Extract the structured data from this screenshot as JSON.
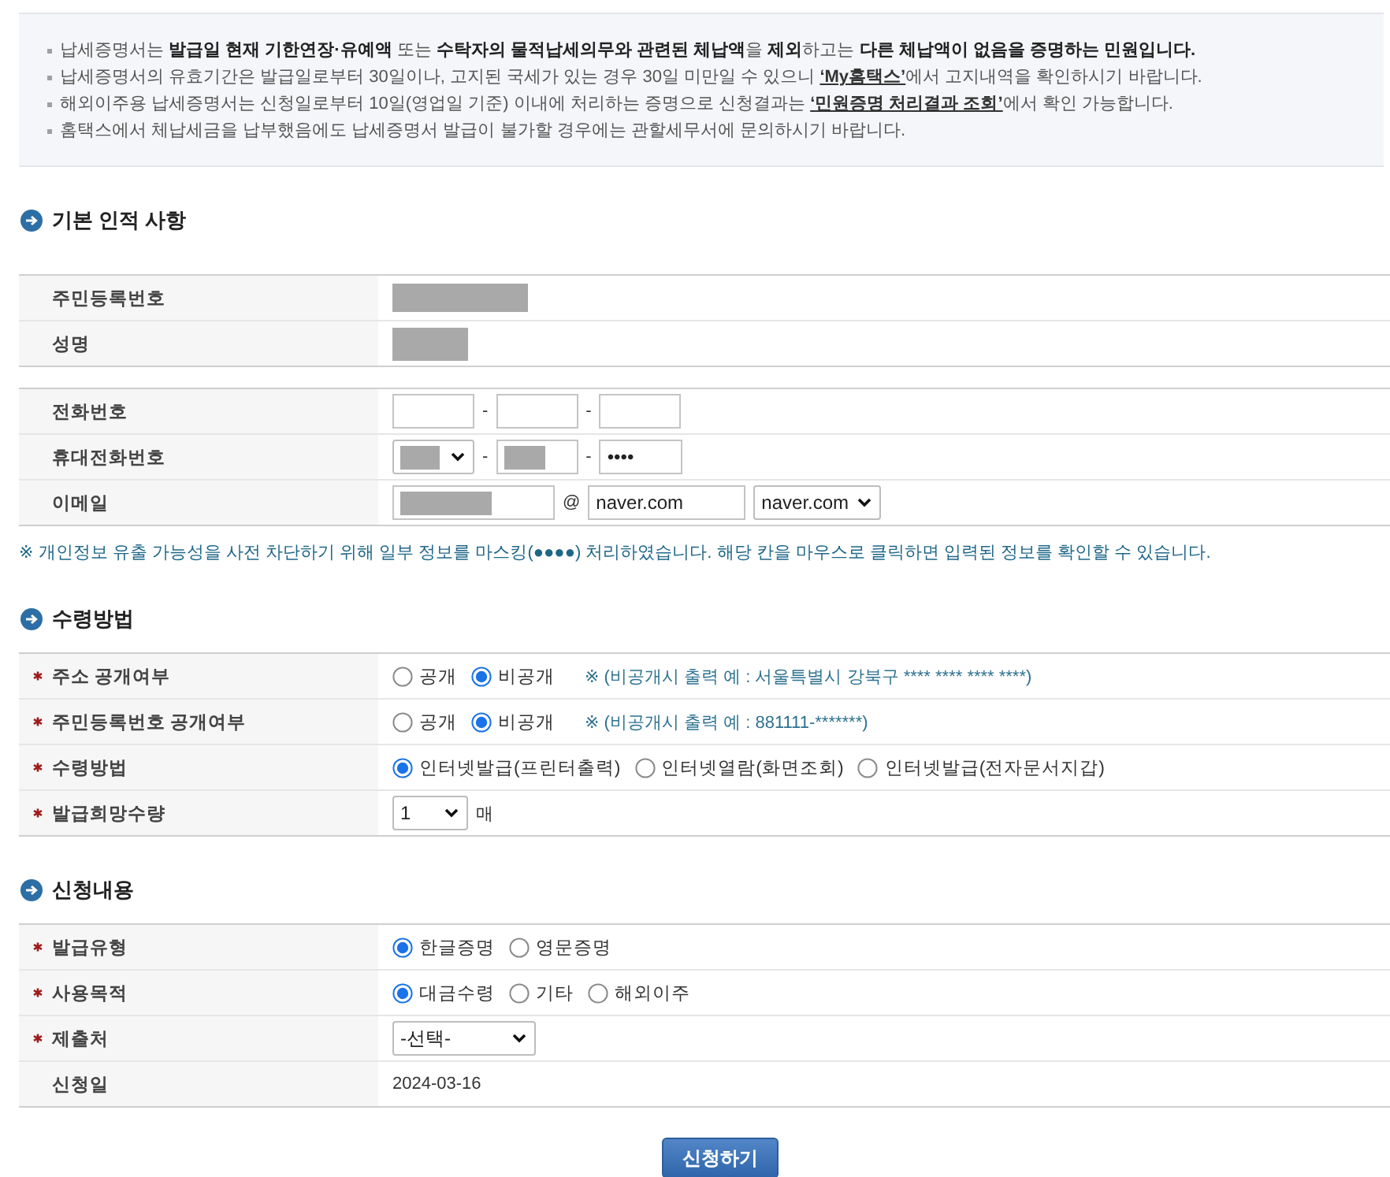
{
  "notice": {
    "items": [
      {
        "parts": [
          {
            "kind": "text",
            "text": "납세증명서는 **발급일 현재 기한연장·유예액** 또는 **수탁자의 물적납세의무와 관련된 체납액**을 **제외**하고는 **다른 체납액이 없음을 증명하는 민원입니다.**"
          }
        ]
      },
      {
        "parts": [
          {
            "kind": "text",
            "text": "납세증명서의 유효기간은 발급일로부터 30일이나, 고지된 국세가 있는 경우 30일 미만일 수 있으니 "
          },
          {
            "kind": "link",
            "text": "‘My홈택스’"
          },
          {
            "kind": "text",
            "text": "에서 고지내역을 확인하시기 바랍니다."
          }
        ]
      },
      {
        "parts": [
          {
            "kind": "text",
            "text": "해외이주용 납세증명서는 신청일로부터 10일(영업일 기준) 이내에 처리하는 증명으로 신청결과는 "
          },
          {
            "kind": "link",
            "text": "‘민원증명 처리결과 조회’"
          },
          {
            "kind": "text",
            "text": "에서 확인 가능합니다."
          }
        ]
      },
      {
        "parts": [
          {
            "kind": "text",
            "text": "홈택스에서 체납세금을 납부했음에도 납세증명서 발급이 불가할 경우에는 관할세무서에 문의하시기 바랍니다."
          }
        ]
      }
    ]
  },
  "sections": [
    {
      "title": "기본 인적 사항",
      "tables": [
        {
          "rows": [
            {
              "label": "주민등록번호",
              "required": false,
              "fields": [
                {
                  "kind": "redacted"
                }
              ]
            },
            {
              "label": "성명",
              "required": false,
              "fields": [
                {
                  "kind": "redacted"
                }
              ]
            }
          ]
        },
        {
          "rows": [
            {
              "label": "전화번호",
              "required": false,
              "fields": [
                {
                  "kind": "input",
                  "redacted": false
                },
                {
                  "kind": "text",
                  "text": "-"
                },
                {
                  "kind": "input",
                  "redacted": false
                },
                {
                  "kind": "text",
                  "text": "-"
                },
                {
                  "kind": "input",
                  "redacted": false
                }
              ]
            },
            {
              "label": "휴대전화번호",
              "required": false,
              "fields": [
                {
                  "kind": "select",
                  "redacted": true
                },
                {
                  "kind": "text",
                  "text": "-"
                },
                {
                  "kind": "input",
                  "redacted": true
                },
                {
                  "kind": "text",
                  "text": "-"
                },
                {
                  "kind": "input",
                  "redacted": false,
                  "value": "••••"
                }
              ]
            },
            {
              "label": "이메일",
              "required": false,
              "fields": [
                {
                  "kind": "input",
                  "redacted": true
                },
                {
                  "kind": "text",
                  "text": "@"
                },
                {
                  "kind": "input",
                  "redacted": false,
                  "value": "naver.com"
                },
                {
                  "kind": "select",
                  "redacted": false,
                  "value": "naver.com"
                }
              ]
            }
          ]
        }
      ],
      "note": "※ 개인정보 유출 가능성을 사전 차단하기 위해 일부 정보를 마스킹(●●●●) 처리하였습니다. 해당 칸을 마우스로 클릭하면 입력된 정보를 확인할 수 있습니다."
    },
    {
      "title": "수령방법",
      "tables": [
        {
          "rows": [
            {
              "label": "주소 공개여부",
              "required": true,
              "fields": [
                {
                  "kind": "radio",
                  "options": [
                    {
                      "label": "공개",
                      "selected": false
                    },
                    {
                      "label": "비공개",
                      "selected": true
                    }
                  ]
                },
                {
                  "kind": "note",
                  "text": "※ (비공개시 출력 예 : 서울특별시 강북구 **** **** **** ****)"
                }
              ]
            },
            {
              "label": "주민등록번호 공개여부",
              "required": true,
              "fields": [
                {
                  "kind": "radio",
                  "options": [
                    {
                      "label": "공개",
                      "selected": false
                    },
                    {
                      "label": "비공개",
                      "selected": true
                    }
                  ]
                },
                {
                  "kind": "note",
                  "text": "※ (비공개시 출력 예 : 881111-*******)"
                }
              ]
            },
            {
              "label": "수령방법",
              "required": true,
              "fields": [
                {
                  "kind": "radio",
                  "options": [
                    {
                      "label": "인터넷발급(프린터출력)",
                      "selected": true
                    },
                    {
                      "label": "인터넷열람(화면조회)",
                      "selected": false
                    },
                    {
                      "label": "인터넷발급(전자문서지갑)",
                      "selected": false
                    }
                  ]
                }
              ]
            },
            {
              "label": "발급희망수량",
              "required": true,
              "fields": [
                {
                  "kind": "select",
                  "redacted": false,
                  "value": "1"
                },
                {
                  "kind": "text",
                  "text": "매"
                }
              ]
            }
          ]
        }
      ]
    },
    {
      "title": "신청내용",
      "tables": [
        {
          "rows": [
            {
              "label": "발급유형",
              "required": true,
              "fields": [
                {
                  "kind": "radio",
                  "options": [
                    {
                      "label": "한글증명",
                      "selected": true
                    },
                    {
                      "label": "영문증명",
                      "selected": false
                    }
                  ]
                }
              ]
            },
            {
              "label": "사용목적",
              "required": true,
              "fields": [
                {
                  "kind": "radio",
                  "options": [
                    {
                      "label": "대금수령",
                      "selected": true
                    },
                    {
                      "label": "기타",
                      "selected": false
                    },
                    {
                      "label": "해외이주",
                      "selected": false
                    }
                  ]
                }
              ]
            },
            {
              "label": "제출처",
              "required": true,
              "fields": [
                {
                  "kind": "select",
                  "redacted": false,
                  "value": "-선택-"
                }
              ]
            },
            {
              "label": "신청일",
              "required": false,
              "fields": [
                {
                  "kind": "text",
                  "text": "2024-03-16"
                }
              ]
            }
          ]
        }
      ]
    }
  ],
  "submit": {
    "label": "신청하기"
  }
}
